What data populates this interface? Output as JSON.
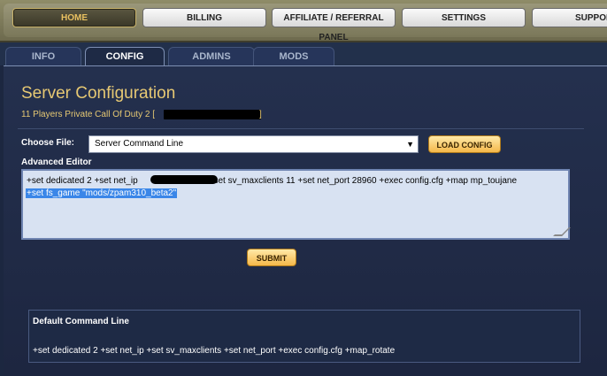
{
  "nav": {
    "items": [
      {
        "label": "HOME",
        "active": true
      },
      {
        "label": "BILLING"
      },
      {
        "label": "AFFILIATE / REFERRAL PANEL"
      },
      {
        "label": "SETTINGS"
      },
      {
        "label": "SUPPOR"
      }
    ]
  },
  "tabs": [
    {
      "label": "INFO"
    },
    {
      "label": "CONFIG",
      "active": true
    },
    {
      "label": "ADMINS"
    },
    {
      "label": "MODS"
    }
  ],
  "page": {
    "title": "Server Configuration",
    "subtitle": "11 Players Private Call Of Duty 2 [",
    "subtitle_end": "]"
  },
  "choose_file": {
    "label": "Choose File:",
    "selected": "Server Command Line",
    "load_button": "LOAD CONFIG"
  },
  "editor": {
    "label": "Advanced Editor",
    "line1_a": "+set dedicated 2 +set net_ip",
    "line1_b": "+set sv_maxclients 11 +set net_port 28960 +exec config.cfg +map mp_toujane",
    "line2": "+set fs_game \"mods/zpam310_beta2\""
  },
  "submit_button": "SUBMIT",
  "default_panel": {
    "title": "Default Command Line",
    "text": "+set dedicated 2 +set net_ip +set sv_maxclients +set net_port +exec config.cfg +map_rotate"
  },
  "colors": {
    "accent_gold": "#e6c873",
    "background": "#1c2740",
    "selection": "#3a86e8"
  }
}
